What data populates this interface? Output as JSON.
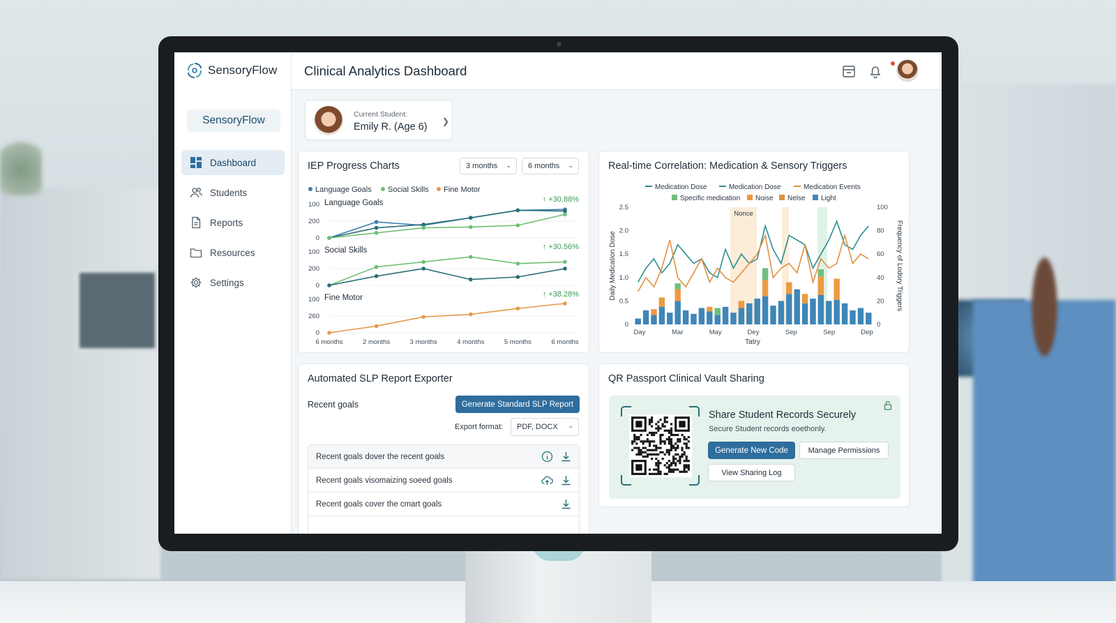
{
  "app": {
    "name": "SensoryFlow",
    "brand_chip": "SensoryFlow"
  },
  "sidebar": {
    "items": [
      {
        "label": "Dashboard",
        "icon": "dashboard-icon",
        "active": true
      },
      {
        "label": "Students",
        "icon": "users-icon"
      },
      {
        "label": "Reports",
        "icon": "document-icon"
      },
      {
        "label": "Resources",
        "icon": "folder-icon"
      },
      {
        "label": "Settings",
        "icon": "gear-icon"
      }
    ]
  },
  "header": {
    "title": "Clinical Analytics Dashboard"
  },
  "student": {
    "label": "Current Student:",
    "name": "Emily R. (Age 6)"
  },
  "iep": {
    "title": "IEP Progress Charts",
    "dropdown1": "3 months",
    "dropdown2": "6 months",
    "legend": [
      "Language Goals",
      "Social Skills",
      "Fine Motor"
    ],
    "colors": {
      "language": "#3d7fb3",
      "social": "#6fbf73",
      "motor": "#e39a4b",
      "dark": "#2a6f77"
    }
  },
  "chart_data": [
    {
      "type": "line",
      "title": "IEP Progress Charts",
      "categories": [
        "6 months",
        "2 months",
        "3 months",
        "4 months",
        "5 months",
        "6 months"
      ],
      "panels": [
        {
          "label": "Language Goals",
          "ticks": [
            "100",
            "200",
            "0"
          ],
          "change": "+30.88%",
          "series": [
            {
              "name": "",
              "values": [
                0,
                95,
                75,
                120,
                165,
                170
              ]
            },
            {
              "name": "",
              "values": [
                0,
                60,
                80,
                120,
                165,
                160
              ]
            },
            {
              "name": "",
              "values": [
                0,
                30,
                60,
                65,
                75,
                140
              ]
            }
          ]
        },
        {
          "label": "Social Skills",
          "ticks": [
            "100",
            "200",
            "0"
          ],
          "change": "+30.56%",
          "series": [
            {
              "name": "",
              "values": [
                0,
                110,
                140,
                170,
                130,
                140
              ]
            },
            {
              "name": "",
              "values": [
                0,
                55,
                100,
                35,
                50,
                100
              ]
            }
          ]
        },
        {
          "label": "Fine Motor",
          "ticks": [
            "100",
            "260",
            "0"
          ],
          "change": "+38.28%",
          "series": [
            {
              "name": "",
              "values": [
                0,
                40,
                95,
                110,
                145,
                175
              ]
            }
          ]
        }
      ]
    },
    {
      "type": "bar",
      "title": "Real-time Correlation: Medication & Sensory Triggers",
      "legend_row1": [
        "Medication Dose",
        "Medication Dose",
        "Medication Events"
      ],
      "legend_row2": [
        "Specific medication",
        "Noise",
        "Nelse",
        "Light"
      ],
      "xlabel": "Tatry",
      "ylabel": "Daily Medication Dose",
      "y2label": "Frequency of Lodory Triggers",
      "x_ticks": [
        "Day",
        "Mar",
        "May",
        "Dey",
        "Sep",
        "Sep",
        "Dep"
      ],
      "y_ticks": [
        "2.5",
        "2.0",
        "1.5",
        "1.0",
        "0.5",
        "0"
      ],
      "y2_ticks": [
        "100",
        "80",
        "60",
        "40",
        "20",
        "0"
      ],
      "ylim": [
        0,
        2.5
      ],
      "y2lim": [
        0,
        100
      ],
      "band_label": "Nonce",
      "series": [
        {
          "name": "Medication Dose",
          "values": [
            0.9,
            1.2,
            1.4,
            1.1,
            1.3,
            1.7,
            1.5,
            1.3,
            1.4,
            1.1,
            1.0,
            1.6,
            1.2,
            1.5,
            1.3,
            1.4,
            2.1,
            1.6,
            1.3,
            1.9,
            1.8,
            1.7,
            1.2,
            1.5,
            1.8,
            2.2,
            1.7,
            1.6,
            1.9,
            2.1
          ]
        },
        {
          "name": "Medication Dose",
          "values": [
            0.7,
            1.0,
            0.8,
            1.2,
            1.8,
            1.0,
            0.8,
            1.1,
            1.4,
            0.9,
            1.2,
            1.0,
            0.9,
            1.1,
            1.3,
            1.5,
            1.9,
            1.0,
            1.2,
            1.3,
            1.1,
            1.7,
            0.9,
            1.4,
            1.2,
            1.3,
            1.9,
            1.3,
            1.5,
            1.4
          ]
        }
      ],
      "bars": [
        {
          "name": "Light",
          "values": [
            5,
            12,
            8,
            15,
            10,
            20,
            12,
            9,
            14,
            11,
            8,
            15,
            10,
            14,
            18,
            22,
            24,
            16,
            20,
            26,
            30,
            18,
            22,
            25,
            20,
            21,
            18,
            12,
            14,
            10
          ]
        },
        {
          "name": "Noise",
          "values": [
            0,
            0,
            5,
            8,
            0,
            10,
            0,
            0,
            0,
            4,
            0,
            0,
            0,
            6,
            0,
            0,
            14,
            0,
            0,
            10,
            0,
            8,
            0,
            16,
            0,
            18,
            0,
            0,
            0,
            0
          ]
        },
        {
          "name": "Specific medication",
          "values": [
            0,
            0,
            0,
            0,
            0,
            5,
            0,
            0,
            0,
            0,
            6,
            0,
            0,
            0,
            0,
            0,
            10,
            0,
            0,
            0,
            0,
            0,
            0,
            6,
            0,
            0,
            0,
            0,
            0,
            0
          ]
        }
      ]
    }
  ],
  "slp": {
    "title": "Automated SLP Report Exporter",
    "recent_label": "Recent goals",
    "generate_label": "Generate Standard SLP Report",
    "export_label": "Export format:",
    "export_value": "PDF, DOCX",
    "rows": [
      "Recent goals dover the recent goals",
      "Recent goals visomaizing soeed goals",
      "Recent goals cover the cmart goals"
    ]
  },
  "qr": {
    "title": "QR Passport Clinical Vault Sharing",
    "heading": "Share Student Records Securely",
    "sub": "Secure Student records eoethonly.",
    "generate_label": "Generate New Code",
    "manage_label": "Manage Permissions",
    "log_label": "View Sharing Log"
  }
}
